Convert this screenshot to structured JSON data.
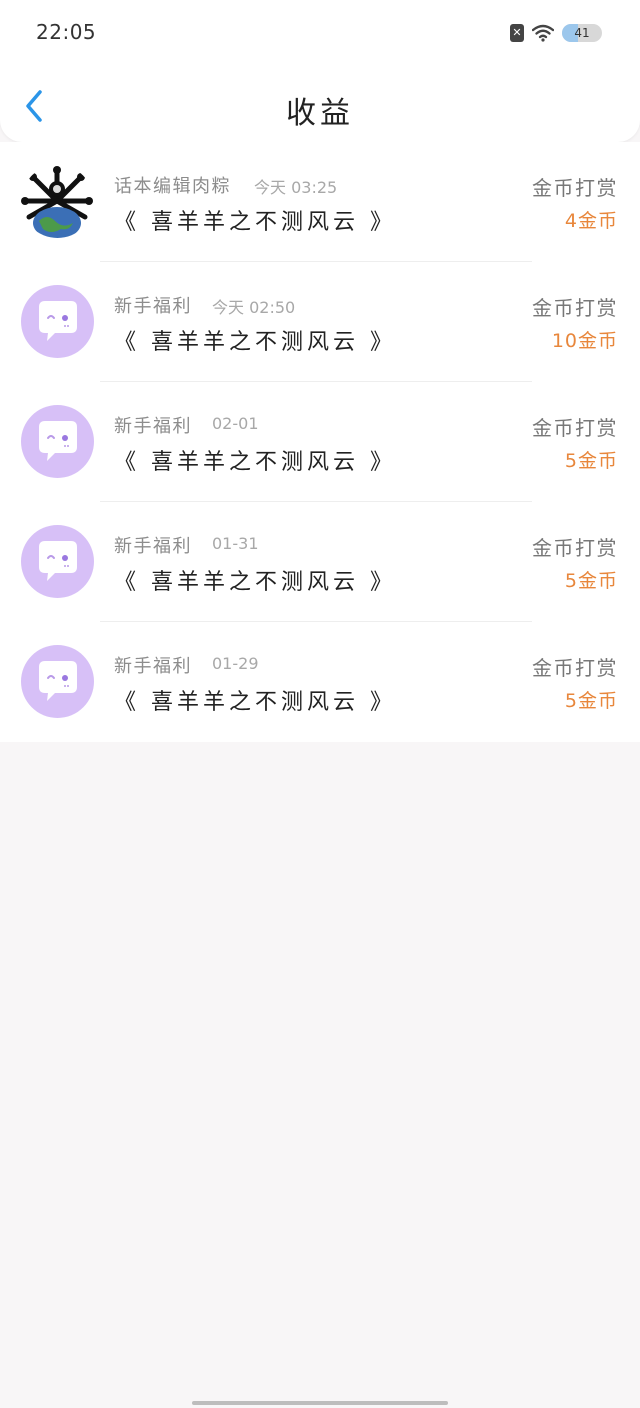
{
  "status_bar": {
    "time": "22:05",
    "battery": "41",
    "battery_level": 0.41,
    "icons": [
      "sim-off-icon",
      "wifi-icon",
      "battery-icon"
    ]
  },
  "nav": {
    "back_icon": "chevron-left-icon",
    "title": "收益"
  },
  "colors": {
    "accent": "#2b95e8",
    "amount": "#e8873c",
    "avatar_bg": "#d7c0f7"
  },
  "items": [
    {
      "source": "话本编辑肉粽",
      "time": "今天 03:25",
      "work": "《 喜羊羊之不测风云 》",
      "reward_type": "金币打赏",
      "amount": "4金币",
      "avatar": "editor-avatar"
    },
    {
      "source": "新手福利",
      "time": "今天 02:50",
      "work": "《 喜羊羊之不测风云 》",
      "reward_type": "金币打赏",
      "amount": "10金币",
      "avatar": "chat-bubble-avatar"
    },
    {
      "source": "新手福利",
      "time": "02-01",
      "work": "《 喜羊羊之不测风云 》",
      "reward_type": "金币打赏",
      "amount": "5金币",
      "avatar": "chat-bubble-avatar"
    },
    {
      "source": "新手福利",
      "time": "01-31",
      "work": "《 喜羊羊之不测风云 》",
      "reward_type": "金币打赏",
      "amount": "5金币",
      "avatar": "chat-bubble-avatar"
    },
    {
      "source": "新手福利",
      "time": "01-29",
      "work": "《 喜羊羊之不测风云 》",
      "reward_type": "金币打赏",
      "amount": "5金币",
      "avatar": "chat-bubble-avatar"
    }
  ]
}
